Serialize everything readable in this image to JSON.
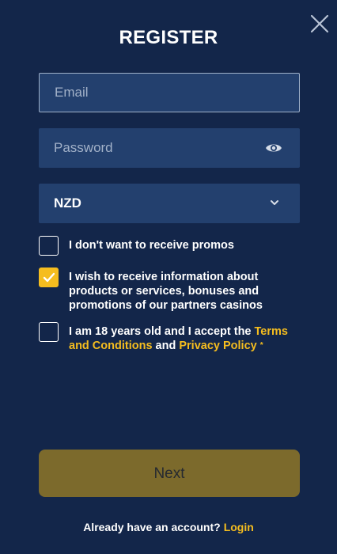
{
  "dialog": {
    "title": "REGISTER",
    "close_icon": "close-icon"
  },
  "form": {
    "email": {
      "placeholder": "Email",
      "value": ""
    },
    "password": {
      "placeholder": "Password",
      "value": "",
      "icon": "eye-icon"
    },
    "currency": {
      "value": "NZD",
      "icon": "chevron-down-icon"
    }
  },
  "checkboxes": {
    "no_promos": {
      "label": "I don't want to receive promos",
      "checked": false
    },
    "partner_info": {
      "label": "I wish to receive information about products or services, bonuses and promotions of our partners casinos",
      "checked": true
    },
    "terms": {
      "label_prefix": "I am 18 years old and I accept the ",
      "terms_link": "Terms and Conditions",
      "and_text": " and ",
      "privacy_link": "Privacy Policy",
      "required_mark": "*",
      "checked": false
    }
  },
  "next_button": {
    "label": "Next"
  },
  "footer": {
    "prompt": "Already have an account?",
    "login_link": "Login"
  },
  "colors": {
    "background": "#13264a",
    "field_background": "#23406e",
    "accent": "#f5bd1f",
    "next_button_background": "#7c6a2c"
  }
}
